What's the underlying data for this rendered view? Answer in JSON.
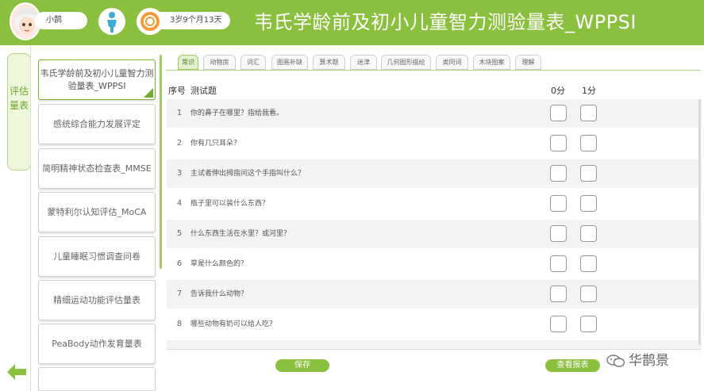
{
  "header": {
    "user_name": "小鹊",
    "age": "3岁9个月13天",
    "title": "韦氏学龄前及初小儿童智力测验量表_WPPSI",
    "background_color": "#8bbf3e"
  },
  "left_nav": {
    "tab_label": "评估量表",
    "back_icon": "arrow-left-icon"
  },
  "scales": [
    "韦氏学龄前及初小儿童智力测验量表_WPPSI",
    "感统综合能力发展评定",
    "简明精神状态检查表_MMSE",
    "蒙特利尔认知评估_MoCA",
    "儿童睡眠习惯调查问卷",
    "精细运动功能评估量表",
    "PeaBody动作发育量表"
  ],
  "tabs": [
    "常识",
    "动物房",
    "词汇",
    "图画补缺",
    "算术题",
    "迷津",
    "几何图形描绘",
    "类同词",
    "木块图案",
    "理解"
  ],
  "table": {
    "col_seq": "序号",
    "col_question": "测试题",
    "col_score0": "0分",
    "col_score1": "1分",
    "questions": [
      {
        "num": "1",
        "text": "你的鼻子在哪里？指给我看。"
      },
      {
        "num": "2",
        "text": "你有几只耳朵？"
      },
      {
        "num": "3",
        "text": "主试者伸出拇指问这个手指叫什么？"
      },
      {
        "num": "4",
        "text": "瓶子里可以装什么东西？"
      },
      {
        "num": "5",
        "text": "什么东西生活在水里？或河里？"
      },
      {
        "num": "6",
        "text": "草是什么颜色的？"
      },
      {
        "num": "7",
        "text": "告诉我什么动物？"
      },
      {
        "num": "8",
        "text": "哪些动物有奶可以给人吃？"
      }
    ]
  },
  "buttons": {
    "save": "保存",
    "report": "查看报表"
  },
  "watermark": "华鹊景",
  "colors": {
    "accent": "#8bbf3e",
    "accent_dark": "#6fae2c"
  }
}
